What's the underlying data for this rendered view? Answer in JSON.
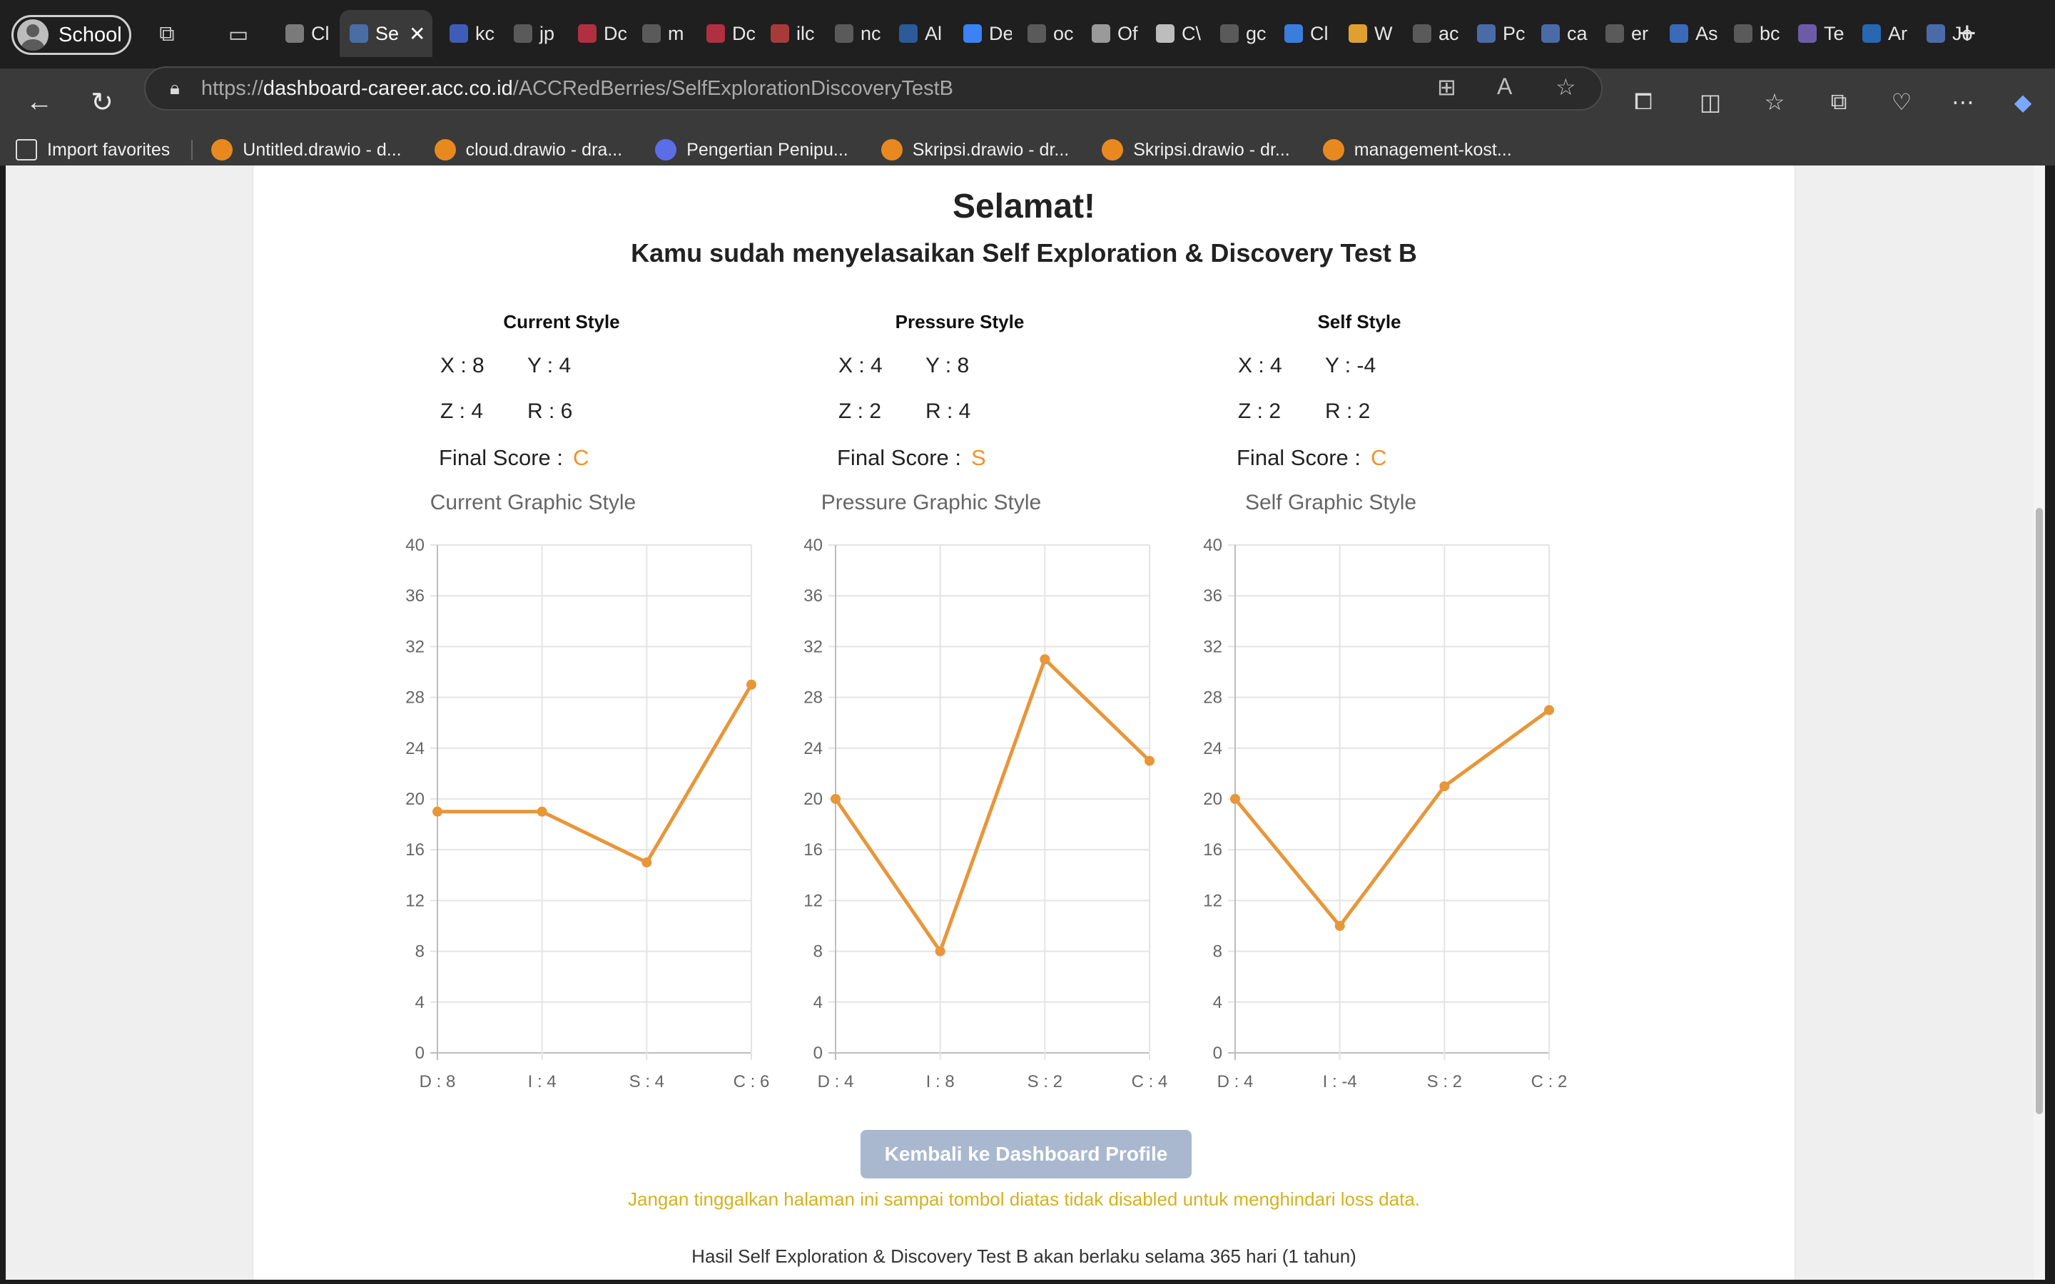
{
  "browser": {
    "profile": "School",
    "tabs": [
      {
        "label": "Cl",
        "color": "#7a7a7a"
      },
      {
        "label": "Se",
        "color": "#4a6da7",
        "active": true
      },
      {
        "label": "kc",
        "color": "#3e5cb8"
      },
      {
        "label": "jp",
        "color": "#5a5a5a"
      },
      {
        "label": "Dc",
        "color": "#b03040"
      },
      {
        "label": "m",
        "color": "#5a5a5a"
      },
      {
        "label": "Dc",
        "color": "#b03040"
      },
      {
        "label": "ilc",
        "color": "#a83a3a"
      },
      {
        "label": "nc",
        "color": "#5a5a5a"
      },
      {
        "label": "Al",
        "color": "#2c5a9a"
      },
      {
        "label": "De",
        "color": "#3b82f6"
      },
      {
        "label": "oc",
        "color": "#5a5a5a"
      },
      {
        "label": "Of",
        "color": "#9a9a9a"
      },
      {
        "label": "C\\",
        "color": "#bdbdbd"
      },
      {
        "label": "gc",
        "color": "#5a5a5a"
      },
      {
        "label": "Cl",
        "color": "#3b7ddd"
      },
      {
        "label": "W",
        "color": "#e0a030"
      },
      {
        "label": "ac",
        "color": "#5a5a5a"
      },
      {
        "label": "Pc",
        "color": "#4b6aa8"
      },
      {
        "label": "ca",
        "color": "#4b6aa8"
      },
      {
        "label": "er",
        "color": "#5a5a5a"
      },
      {
        "label": "As",
        "color": "#3a6ab8"
      },
      {
        "label": "bc",
        "color": "#5a5a5a"
      },
      {
        "label": "Te",
        "color": "#6b5ca8"
      },
      {
        "label": "Ar",
        "color": "#2867b2"
      },
      {
        "label": "Jo",
        "color": "#4b6aa8"
      }
    ],
    "url_scheme": "https://",
    "url_host": "dashboard-career.acc.co.id",
    "url_path": "/ACCRedBerries/SelfExplorationDiscoveryTestB",
    "favorites": [
      {
        "label": "Import favorites",
        "icon": "folder-icon"
      },
      {
        "label": "Untitled.drawio - d..."
      },
      {
        "label": "cloud.drawio - dra..."
      },
      {
        "label": "Pengertian Penipu..."
      },
      {
        "label": "Skripsi.drawio - dr..."
      },
      {
        "label": "Skripsi.drawio - dr..."
      },
      {
        "label": "management-kost..."
      }
    ]
  },
  "page": {
    "heading": "Selamat!",
    "subheading": "Kamu sudah menyelasaikan Self Exploration & Discovery Test B",
    "final_label": "Final Score :",
    "back_button": "Kembali ke Dashboard Profile",
    "warning": "Jangan tinggalkan halaman ini sampai tombol diatas tidak disabled untuk menghindari loss data.",
    "validity": "Hasil Self Exploration & Discovery Test B akan berlaku selama 365 hari (1 tahun)",
    "accent_color": "#f0922b"
  },
  "styles": [
    {
      "heading": "Current Style",
      "x": "X : 8",
      "y": "Y : 4",
      "z": "Z : 4",
      "r": "R : 6",
      "final": "C",
      "chart_title": "Current Graphic Style"
    },
    {
      "heading": "Pressure Style",
      "x": "X : 4",
      "y": "Y : 8",
      "z": "Z : 2",
      "r": "R : 4",
      "final": "S",
      "chart_title": "Pressure Graphic Style"
    },
    {
      "heading": "Self Style",
      "x": "X : 4",
      "y": "Y : -4",
      "z": "Z : 2",
      "r": "R : 2",
      "final": "C",
      "chart_title": "Self Graphic Style"
    }
  ],
  "chart_data": [
    {
      "type": "line",
      "title": "Current Graphic Style",
      "categories": [
        "D : 8",
        "I : 4",
        "S : 4",
        "C : 6"
      ],
      "values": [
        19,
        19,
        15,
        29
      ],
      "ylim": [
        0,
        40
      ],
      "yticks": [
        0,
        4,
        8,
        12,
        16,
        20,
        24,
        28,
        32,
        36,
        40
      ],
      "grid": true,
      "color": "#e8963a"
    },
    {
      "type": "line",
      "title": "Pressure Graphic Style",
      "categories": [
        "D : 4",
        "I : 8",
        "S : 2",
        "C : 4"
      ],
      "values": [
        20,
        8,
        31,
        23
      ],
      "ylim": [
        0,
        40
      ],
      "yticks": [
        0,
        4,
        8,
        12,
        16,
        20,
        24,
        28,
        32,
        36,
        40
      ],
      "grid": true,
      "color": "#e8963a"
    },
    {
      "type": "line",
      "title": "Self Graphic Style",
      "categories": [
        "D : 4",
        "I : -4",
        "S : 2",
        "C : 2"
      ],
      "values": [
        20,
        10,
        21,
        27
      ],
      "ylim": [
        0,
        40
      ],
      "yticks": [
        0,
        4,
        8,
        12,
        16,
        20,
        24,
        28,
        32,
        36,
        40
      ],
      "grid": true,
      "color": "#e8963a"
    }
  ]
}
